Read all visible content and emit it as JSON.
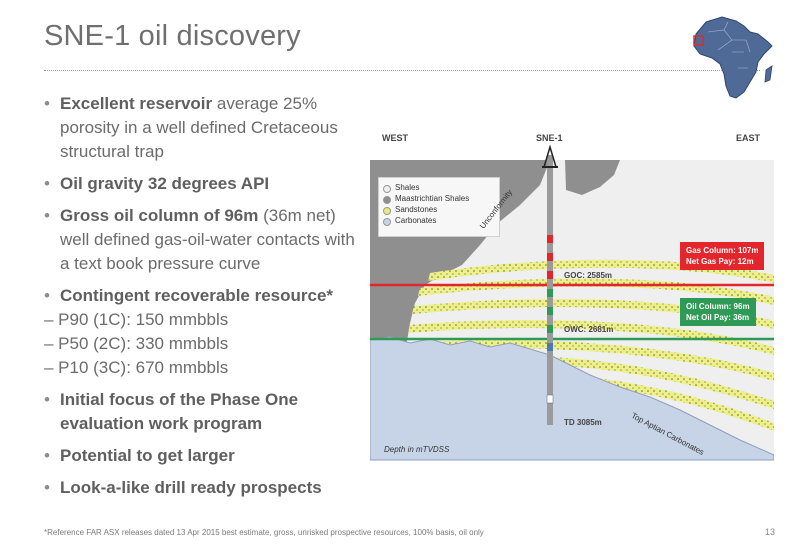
{
  "header": {
    "title": "SNE-1 oil discovery"
  },
  "bullets": {
    "b1_bold": "Excellent reservoir",
    "b1_rest": " average 25% porosity in a well defined Cretaceous structural trap",
    "b2_bold": "Oil gravity 32 degrees API",
    "b3_bold": "Gross oil column of 96m",
    "b3_rest": " (36m net) well defined gas-oil-water contacts with a text book pressure curve",
    "b4_bold": "Contingent recoverable resource*",
    "sub1": "– P90 (1C): 150 mmbbls",
    "sub2": "– P50 (2C): 330 mmbbls",
    "sub3": "– P10 (3C): 670 mmbbls",
    "b5_bold": "Initial focus of the Phase One evaluation work program",
    "b6_bold": "Potential to get larger",
    "b7_bold": "Look-a-like drill ready prospects"
  },
  "diagram": {
    "west": "WEST",
    "well": "SNE-1",
    "east": "EAST",
    "legend": [
      "Shales",
      "Maastrichtian Shales",
      "Sandstones",
      "Carbonates"
    ],
    "unconformity": "Unconformity",
    "goc": "GOC: 2585m",
    "owc": "OWC: 2681m",
    "td": "TD 3085m",
    "gas_line1": "Gas Column: 107m",
    "gas_line2": "Net Gas Pay: 12m",
    "oil_line1": "Oil Column: 96m",
    "oil_line2": "Net Oil Pay: 36m",
    "carbonates": "Top Aptian Carbonates",
    "depth": "Depth in mTVDSS"
  },
  "colors": {
    "gas": "#e3262b",
    "oil": "#2e9a55",
    "carbonate": "#c7d4e8",
    "shale": "#8f8f8f",
    "sand": "#e8ec7a"
  },
  "footnote": "*Reference FAR ASX releases dated 13 Apr 2015 best estimate, gross, unrisked prospective resources, 100% basis, oil only",
  "page_number": "13"
}
